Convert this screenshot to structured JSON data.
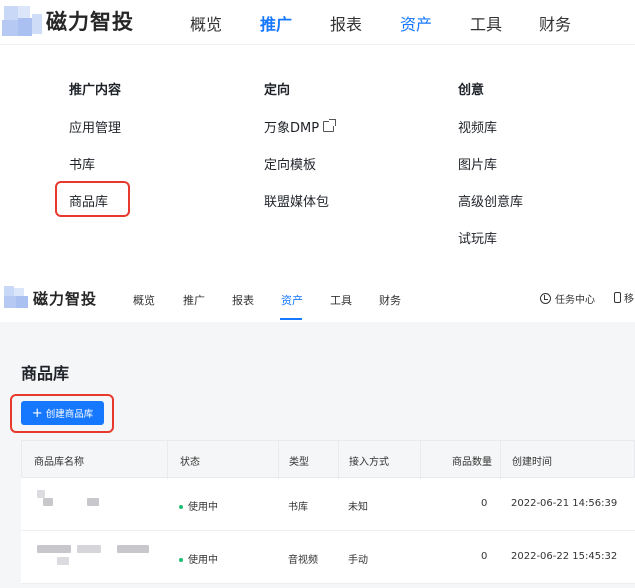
{
  "brand": "磁力智投",
  "topnav": {
    "items": [
      "概览",
      "推广",
      "报表",
      "资产",
      "工具",
      "财务"
    ]
  },
  "dropdown": {
    "columns": [
      {
        "head": "推广内容",
        "items": [
          "应用管理",
          "书库",
          "商品库"
        ]
      },
      {
        "head": "定向",
        "items": [
          "万象DMP",
          "定向模板",
          "联盟媒体包"
        ]
      },
      {
        "head": "创意",
        "items": [
          "视频库",
          "图片库",
          "高级创意库",
          "试玩库"
        ]
      }
    ]
  },
  "subnav": {
    "items": [
      "概览",
      "推广",
      "报表",
      "资产",
      "工具",
      "财务"
    ],
    "active": "资产",
    "task_center": "任务中心",
    "mobile_label": "移"
  },
  "page": {
    "title": "商品库",
    "create_button": "创建商品库"
  },
  "table": {
    "columns": [
      "商品库名称",
      "状态",
      "类型",
      "接入方式",
      "商品数量",
      "创建时间"
    ],
    "rows": [
      {
        "status": "使用中",
        "type": "书库",
        "access": "未知",
        "count": "0",
        "created": "2022-06-21 14:56:39"
      },
      {
        "status": "使用中",
        "type": "音视频",
        "access": "手动",
        "count": "0",
        "created": "2022-06-22 15:45:32"
      }
    ]
  },
  "colors": {
    "accent": "#1677ff",
    "highlight_box": "#e8392e",
    "status_green": "#1dbf73"
  }
}
